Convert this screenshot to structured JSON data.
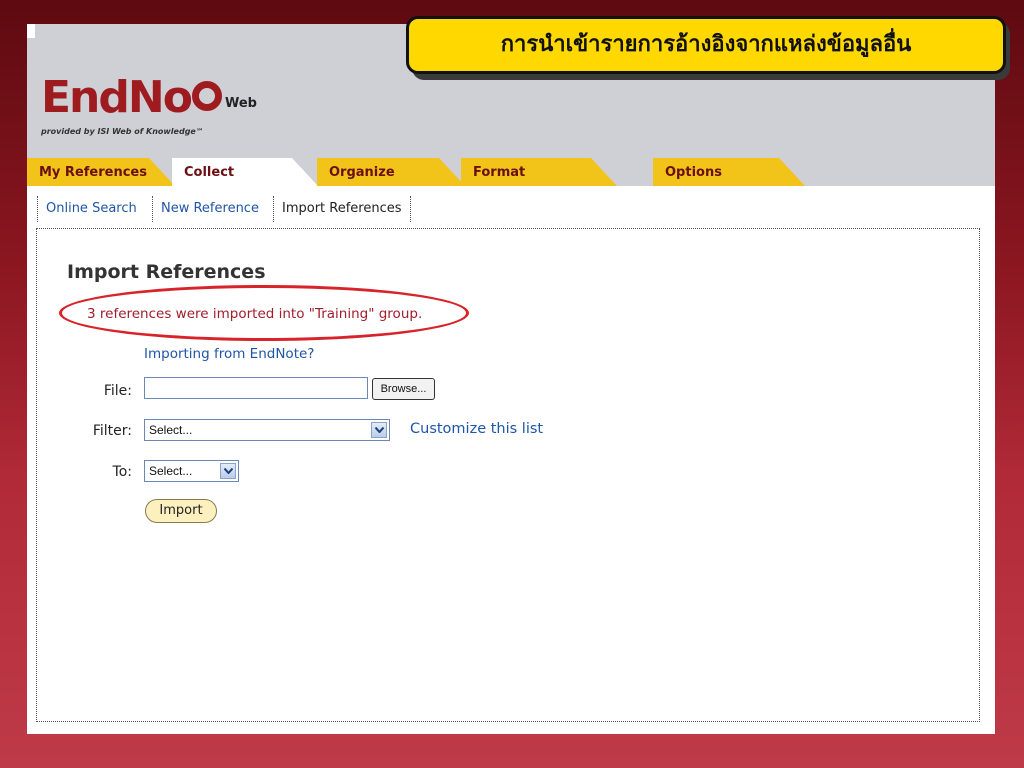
{
  "callout": {
    "text": "การนำเข้ารายการอ้างอิงจากแหล่งข้อมูลอื่น"
  },
  "logo": {
    "word": "EndNo",
    "suffix": "Web",
    "subtitle": "provided by ISI Web of Knowledge℠"
  },
  "tabs": [
    {
      "label": "My References"
    },
    {
      "label": "Collect"
    },
    {
      "label": "Organize"
    },
    {
      "label": "Format"
    },
    {
      "label": "Options"
    }
  ],
  "subnav": [
    {
      "label": "Online Search"
    },
    {
      "label": "New Reference"
    },
    {
      "label": "Import References"
    }
  ],
  "main": {
    "title": "Import References",
    "status": "3 references were imported into \"Training\" group.",
    "endnote_link": "Importing from EndNote?",
    "file_label": "File:",
    "browse_label": "Browse...",
    "filter_label": "Filter:",
    "filter_value": "Select...",
    "customize_link": "Customize this list",
    "to_label": "To:",
    "to_value": "Select...",
    "import_label": "Import"
  },
  "colors": {
    "brand_red": "#9e1b1f",
    "tab_yellow": "#f2c319",
    "link_blue": "#1f55a6",
    "callout_yellow": "#ffd800",
    "highlight_red": "#d8232a"
  },
  "icons": [
    "chevron-down-icon"
  ]
}
